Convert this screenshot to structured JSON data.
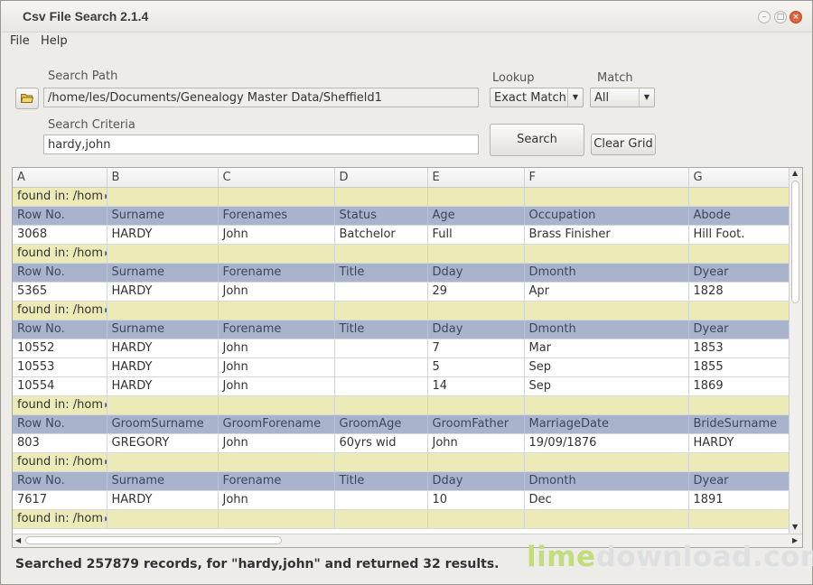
{
  "window": {
    "title": "Csv File Search 2.1.4"
  },
  "menu": {
    "file": "File",
    "help": "Help"
  },
  "search": {
    "path_label": "Search Path",
    "path_value": "/home/les/Documents/Genealogy Master Data/Sheffield1",
    "criteria_label": "Search Criteria",
    "criteria_value": "hardy,john",
    "lookup_label": "Lookup",
    "lookup_value": "Exact Match",
    "match_label": "Match",
    "match_value": "All",
    "search_button": "Search",
    "clear_button": "Clear Grid"
  },
  "grid": {
    "columns": [
      "A",
      "B",
      "C",
      "D",
      "E",
      "F",
      "G"
    ],
    "rows": [
      {
        "type": "found",
        "cells": [
          "found in: /hom",
          "",
          "",
          "",
          "",
          "",
          ""
        ]
      },
      {
        "type": "hdr",
        "cells": [
          "Row No.",
          "Surname",
          "Forenames",
          "Status",
          "Age",
          "Occupation",
          "Abode"
        ]
      },
      {
        "type": "data",
        "cells": [
          "3068",
          "HARDY",
          "John",
          "Batchelor",
          "Full",
          "Brass Finisher",
          "Hill Foot."
        ]
      },
      {
        "type": "found",
        "cells": [
          "found in: /hom",
          "",
          "",
          "",
          "",
          "",
          ""
        ]
      },
      {
        "type": "hdr",
        "cells": [
          "Row No.",
          "Surname",
          "Forename",
          "Title",
          "Dday",
          "Dmonth",
          "Dyear"
        ]
      },
      {
        "type": "data",
        "cells": [
          "5365",
          "HARDY",
          "John",
          "",
          "29",
          "Apr",
          "1828"
        ]
      },
      {
        "type": "found",
        "cells": [
          "found in: /hom",
          "",
          "",
          "",
          "",
          "",
          ""
        ]
      },
      {
        "type": "hdr",
        "cells": [
          "Row No.",
          "Surname",
          "Forename",
          "Title",
          "Dday",
          "Dmonth",
          "Dyear"
        ]
      },
      {
        "type": "data",
        "cells": [
          "10552",
          "HARDY",
          "John",
          "",
          "7",
          "Mar",
          "1853"
        ]
      },
      {
        "type": "data",
        "cells": [
          "10553",
          "HARDY",
          "John",
          "",
          "5",
          "Sep",
          "1855"
        ]
      },
      {
        "type": "data",
        "cells": [
          "10554",
          "HARDY",
          "John",
          "",
          "14",
          "Sep",
          "1869"
        ]
      },
      {
        "type": "found",
        "cells": [
          "found in: /hom",
          "",
          "",
          "",
          "",
          "",
          ""
        ]
      },
      {
        "type": "hdr",
        "cells": [
          "Row No.",
          "GroomSurname",
          "GroomForename",
          "GroomAge",
          "GroomFather",
          "MarriageDate",
          "BrideSurname"
        ]
      },
      {
        "type": "data",
        "cells": [
          "803",
          "GREGORY",
          "John",
          "60yrs wid",
          "John",
          "19/09/1876",
          "HARDY"
        ]
      },
      {
        "type": "found",
        "cells": [
          "found in: /hom",
          "",
          "",
          "",
          "",
          "",
          ""
        ]
      },
      {
        "type": "hdr",
        "cells": [
          "Row No.",
          "Surname",
          "Forename",
          "Title",
          "Dday",
          "Dmonth",
          "Dyear"
        ]
      },
      {
        "type": "data",
        "cells": [
          "7617",
          "HARDY",
          "John",
          "",
          "10",
          "Dec",
          "1891"
        ]
      },
      {
        "type": "found",
        "cells": [
          "found in: /hom",
          "",
          "",
          "",
          "",
          "",
          ""
        ]
      }
    ]
  },
  "status": "Searched 257879 records, for \"hardy,john\" and returned 32 results.",
  "watermark": {
    "part1": "lime",
    "part2": "download.com"
  },
  "icons": {
    "folder": "folder-open-icon",
    "minimize": "minimize-icon",
    "maximize": "maximize-icon",
    "close": "close-icon",
    "dropdown": "chevron-down-icon"
  },
  "colors": {
    "found_row": "#ecebb7",
    "header_row": "#a9b4cc",
    "close_button": "#e0623a"
  }
}
